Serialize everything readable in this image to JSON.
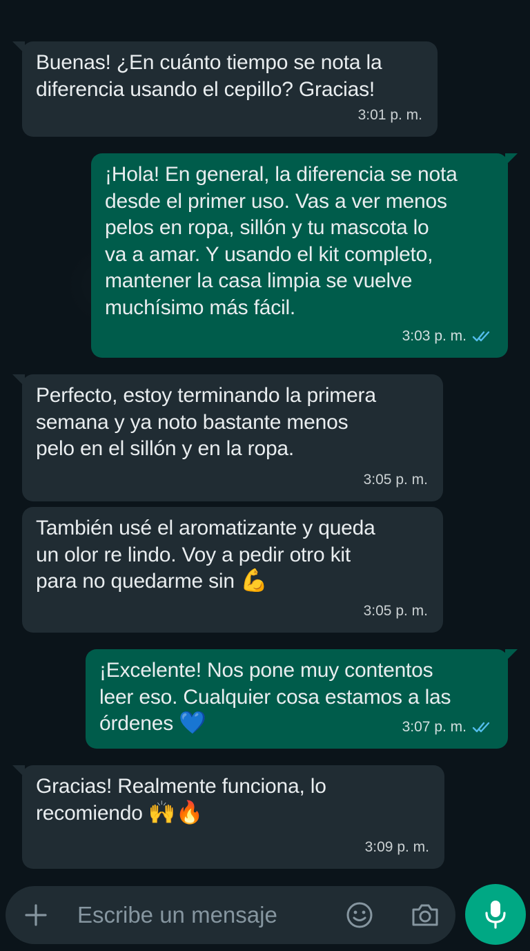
{
  "messages": [
    {
      "direction": "in",
      "text": "Buenas! ¿En cuánto tiempo se nota la\ndiferencia usando el cepillo? Gracias!",
      "time": "3:01 p. m."
    },
    {
      "direction": "out",
      "text": "¡Hola! En general, la diferencia se nota\ndesde el primer uso. Vas a ver menos\npelos en ropa, sillón y tu mascota lo\nva a amar. Y usando el kit completo,\nmantener la casa limpia se vuelve\nmuchísimo más fácil.",
      "time": "3:03 p. m.",
      "status": "read"
    },
    {
      "direction": "in",
      "text": "Perfecto, estoy terminando la primera\nsemana y ya noto bastante menos\npelo en el sillón y en la ropa.",
      "time": "3:05 p. m."
    },
    {
      "direction": "in",
      "text": "También usé el aromatizante y queda\nun olor re lindo. Voy a pedir otro kit\npara no quedarme sin",
      "emoji": "💪",
      "time": "3:05 p. m."
    },
    {
      "direction": "out",
      "text": "¡Excelente! Nos pone muy contentos\nleer eso. Cualquier cosa estamos a las\nórdenes",
      "emoji": "💙",
      "time": "3:07 p. m.",
      "status": "read"
    },
    {
      "direction": "in",
      "text": "Gracias! Realmente funciona, lo\nrecomiendo",
      "emoji": "🙌🔥",
      "time": "3:09 p. m."
    }
  ],
  "composer": {
    "placeholder": "Escribe un mensaje"
  },
  "colors": {
    "background": "#0b141a",
    "incoming_bubble": "#202c33",
    "outgoing_bubble": "#005c4b",
    "read_check": "#53bdeb",
    "mic_button": "#00a884",
    "placeholder_text": "#8696a0"
  },
  "icons": {
    "attach": "plus-icon",
    "emoji": "emoji-icon",
    "camera": "camera-icon",
    "mic": "mic-icon",
    "read_receipt": "double-check-icon"
  }
}
